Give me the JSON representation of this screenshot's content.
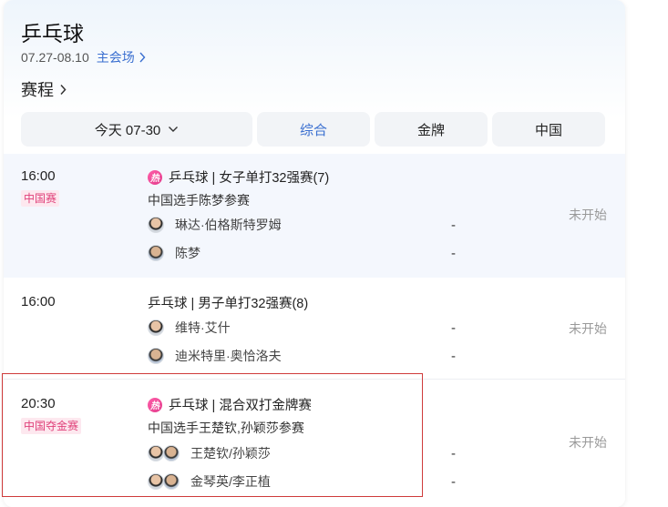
{
  "header": {
    "title": "乒乓球",
    "date_range": "07.27-08.10",
    "venue_link": "主会场"
  },
  "schedule": {
    "heading": "赛程"
  },
  "tabs": {
    "date": "今天 07-30",
    "overall": "综合",
    "gold": "金牌",
    "china": "中国"
  },
  "matches": [
    {
      "time": "16:00",
      "badge": "中国赛",
      "event": "乒乓球 | 女子单打32强赛(7)",
      "hot": true,
      "note": "中国选手陈梦参赛",
      "players": [
        {
          "name": "琳达·伯格斯特罗姆",
          "score": "-"
        },
        {
          "name": "陈梦",
          "score": "-"
        }
      ],
      "status": "未开始"
    },
    {
      "time": "16:00",
      "event": "乒乓球 | 男子单打32强赛(8)",
      "players": [
        {
          "name": "维特·艾什",
          "score": "-"
        },
        {
          "name": "迪米特里·奥恰洛夫",
          "score": "-"
        }
      ],
      "status": "未开始"
    },
    {
      "time": "20:30",
      "badge": "中国夺金赛",
      "event": "乒乓球 | 混合双打金牌赛",
      "hot": true,
      "note": "中国选手王楚钦,孙颖莎参赛",
      "players": [
        {
          "name": "王楚钦/孙颖莎",
          "score": "-"
        },
        {
          "name": "金琴英/李正植",
          "score": "-"
        }
      ],
      "status": "未开始"
    }
  ],
  "hot_icon_text": "热",
  "colors": {
    "accent_blue": "#3a6fd0",
    "badge_pink": "#e0417a",
    "highlight_red": "#cf3b3b",
    "status_gray": "#999999"
  }
}
